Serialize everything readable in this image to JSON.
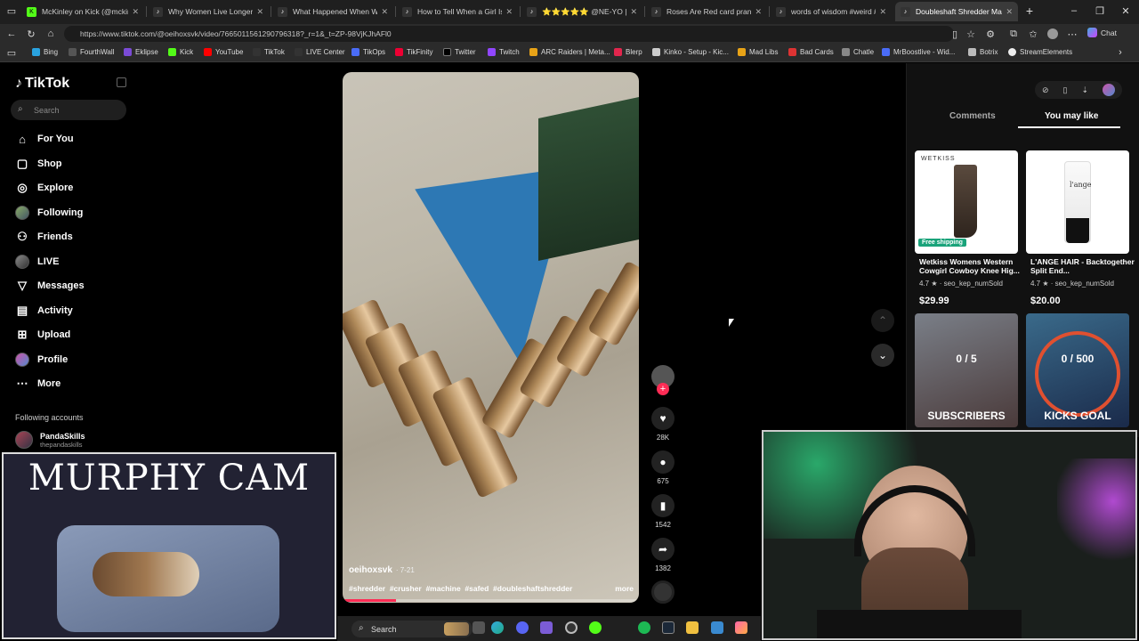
{
  "browser": {
    "tabs": [
      {
        "label": "McKinley on Kick (@mckinley.tv",
        "icon": "kick-icon"
      },
      {
        "label": "Why Women Live Longer Than",
        "icon": "tiktok-icon"
      },
      {
        "label": "What Happened When We Mic",
        "icon": "tiktok-icon"
      },
      {
        "label": "How to Tell When a Girl Is Flirtin",
        "icon": "tiktok-icon"
      },
      {
        "label": "⭐⭐⭐⭐⭐ @NE-YO | ney",
        "icon": "tiktok-icon"
      },
      {
        "label": "Roses Are Red card prank — ca",
        "icon": "tiktok-icon"
      },
      {
        "label": "words of wisdom #weird #funn",
        "icon": "tiktok-icon"
      },
      {
        "label": "Doubleshaft Shredder Ma",
        "icon": "tiktok-icon",
        "active": true
      }
    ],
    "url": "https://www.tiktok.com/@oeihoxsvk/video/7665011561290796318?_r=1&_t=ZP-98VjKJhAFl0",
    "chat_label": "Chat",
    "bookmarks": [
      "Bing",
      "FourthWall",
      "Eklipse",
      "Kick",
      "YouTube",
      "TikTok",
      "LIVE Center",
      "TikOps",
      "TikFinity",
      "Twitter",
      "Twitch",
      "ARC Raiders | Meta...",
      "Blerp",
      "Kinko - Setup - Kic...",
      "Mad Libs",
      "Bad Cards",
      "Chatle",
      "MrBoostlive - Wid...",
      "Botrix",
      "StreamElements"
    ]
  },
  "tiktok": {
    "logo": "TikTok",
    "search_placeholder": "Search",
    "nav": [
      {
        "label": "For You",
        "icon": "home-icon"
      },
      {
        "label": "Shop",
        "icon": "shop-icon"
      },
      {
        "label": "Explore",
        "icon": "compass-icon"
      },
      {
        "label": "Following",
        "icon": "avatar-icon"
      },
      {
        "label": "Friends",
        "icon": "friends-icon"
      },
      {
        "label": "LIVE",
        "icon": "live-icon"
      },
      {
        "label": "Messages",
        "icon": "messages-icon"
      },
      {
        "label": "Activity",
        "icon": "activity-icon"
      },
      {
        "label": "Upload",
        "icon": "upload-icon"
      },
      {
        "label": "Profile",
        "icon": "profile-icon"
      },
      {
        "label": "More",
        "icon": "more-icon"
      }
    ],
    "following_heading": "Following accounts",
    "following": [
      {
        "name": "PandaSkills",
        "handle": "thepandaskills"
      }
    ],
    "video": {
      "author": "oeihoxsvk",
      "date": "· 7-21",
      "hashtags": "#shredder  #crusher  #machine  #safed  #doubleshaftshredder",
      "more": "more"
    },
    "actions": {
      "likes": "28K",
      "comments": "675",
      "saves": "1542",
      "shares": "1382"
    },
    "panel": {
      "tab_comments": "Comments",
      "tab_you_may_like": "You may like",
      "products": [
        {
          "title": "Wetkiss Womens Western Cowgirl Cowboy Knee Hig...",
          "rating": "4.7 ★ · seo_kep_numSold",
          "price": "$29.99",
          "badge": "Free shipping",
          "brand": "WETKISS"
        },
        {
          "title": "L'ANGE HAIR - Backtogether Split End...",
          "rating": "4.7 ★ · seo_kep_numSold",
          "price": "$20.00",
          "brand": "l'ange"
        }
      ],
      "goals": [
        {
          "count": "0 / 5",
          "label": "SUBSCRIBERS"
        },
        {
          "count": "0 / 500",
          "label": "KICKS GOAL"
        }
      ]
    }
  },
  "overlay": {
    "murphy_title": "MURPHY CAM"
  },
  "taskbar": {
    "search_label": "Search"
  },
  "colors": {
    "accent": "#fe2c55",
    "bg": "#000000",
    "panel": "#111111"
  }
}
